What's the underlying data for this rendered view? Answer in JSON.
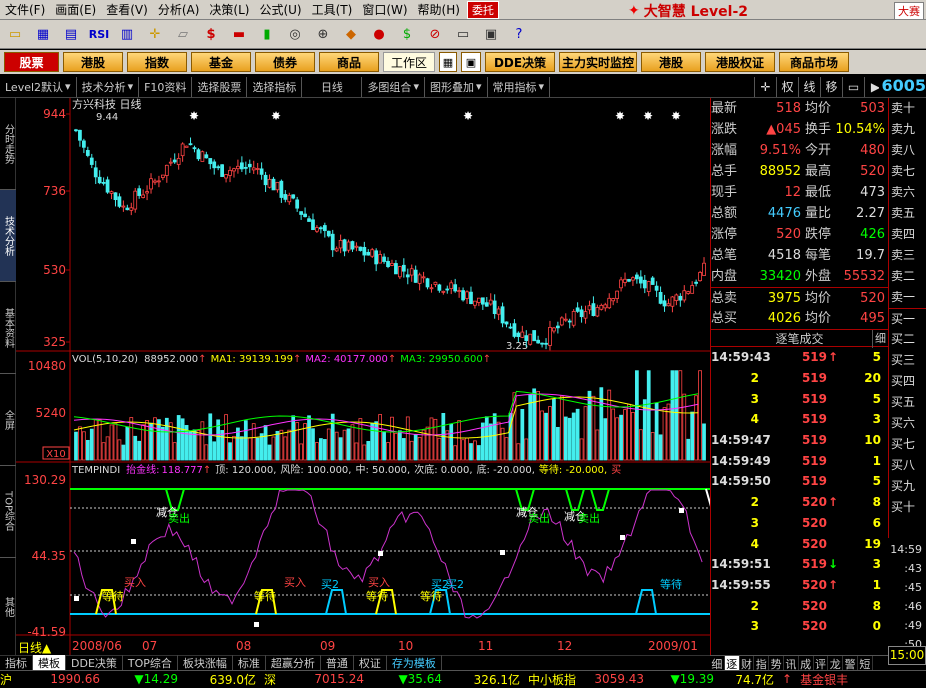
{
  "menu": {
    "items": [
      "文件(F)",
      "画面(E)",
      "查看(V)",
      "分析(A)",
      "决策(L)",
      "公式(U)",
      "工具(T)",
      "窗口(W)",
      "帮助(H)"
    ],
    "weituo": "委托",
    "brand": "大智慧 Level-2",
    "dasai": "大赛"
  },
  "nav": {
    "buttons": [
      "股票",
      "港股",
      "指数",
      "基金",
      "债券",
      "商品"
    ],
    "workzone": "工作区",
    "extra": [
      "DDE决策",
      "主力实时监控",
      "港股",
      "港股权证",
      "商品市场"
    ]
  },
  "tabs": [
    "Level2默认",
    "技术分析",
    "F10资料",
    "选择股票",
    "选择指标",
    "日线",
    "多图组合",
    "图形叠加",
    "常用指标"
  ],
  "tab_icons": [
    "权",
    "线",
    "移"
  ],
  "code_prefix": "6005",
  "left_tabs": [
    "分时走势",
    "技术分析",
    "基本资料",
    "全屏",
    "TOP综合",
    "其他"
  ],
  "chart_data": [
    {
      "type": "candlestick",
      "title": "方兴科技 日线",
      "y_ticks": [
        "944",
        "736",
        "530",
        "325"
      ],
      "ylim": [
        325,
        944
      ],
      "annotations": [
        "9.44",
        "3.25"
      ],
      "note_hi": "9.44",
      "note_lo": "3.25"
    },
    {
      "type": "bar",
      "title": "VOL(5,10,20)",
      "vol_value": "88952.000",
      "series": [
        {
          "name": "MA1",
          "value": "39139.199"
        },
        {
          "name": "MA2",
          "value": "40177.000"
        },
        {
          "name": "MA3",
          "value": "29950.600"
        }
      ],
      "y_ticks": [
        "10480",
        "5240"
      ],
      "unit": "X10"
    },
    {
      "type": "line",
      "title": "TEMPINDI",
      "params_label": "抬金线:",
      "params_value": "118.777",
      "extra": [
        "顶: 120.000,",
        "风险: 100.000,",
        "中: 50.000,",
        "次底: 0.000,",
        "底: -20.000,",
        "等待: -20.000,",
        "买"
      ],
      "y_ticks": [
        "130.29",
        "44.35",
        "-41.59"
      ],
      "signals": [
        "减仓",
        "卖出",
        "减仓",
        "卖出",
        "减仓",
        "卖出",
        "买入",
        "买入",
        "买2",
        "买入",
        "买2",
        "买2",
        "等待",
        "等待",
        "等待",
        "等待",
        "等待"
      ]
    }
  ],
  "x_labels": [
    "2008/06",
    "07",
    "08",
    "09",
    "10",
    "11",
    "12",
    "2009/01"
  ],
  "quote": [
    {
      "l": "最新",
      "v": "518",
      "l2": "均价",
      "v2": "503",
      "c": "#f44",
      "c2": "#f44"
    },
    {
      "l": "涨跌",
      "v": "▲045",
      "l2": "换手",
      "v2": "10.54%",
      "c": "#f44",
      "c2": "#ff0"
    },
    {
      "l": "涨幅",
      "v": "9.51%",
      "l2": "今开",
      "v2": "480",
      "c": "#f44",
      "c2": "#f44"
    },
    {
      "l": "总手",
      "v": "88952",
      "l2": "最高",
      "v2": "520",
      "c": "#ff0",
      "c2": "#f44"
    },
    {
      "l": "现手",
      "v": "12",
      "l2": "最低",
      "v2": "473",
      "c": "#f44",
      "c2": "#ddd"
    },
    {
      "l": "总额",
      "v": "4476",
      "l2": "量比",
      "v2": "2.27",
      "c": "#4cf",
      "c2": "#ddd"
    },
    {
      "l": "涨停",
      "v": "520",
      "l2": "跌停",
      "v2": "426",
      "c": "#f44",
      "c2": "#0f0"
    },
    {
      "l": "总笔",
      "v": "4518",
      "l2": "每笔",
      "v2": "19.7",
      "c": "#ddd",
      "c2": "#ddd"
    },
    {
      "l": "内盘",
      "v": "33420",
      "l2": "外盘",
      "v2": "55532",
      "c": "#0f0",
      "c2": "#f44"
    },
    {
      "l": "总卖",
      "v": "3975",
      "l2": "均价",
      "v2": "520",
      "c": "#ff0",
      "c2": "#f44"
    },
    {
      "l": "总买",
      "v": "4026",
      "l2": "均价",
      "v2": "495",
      "c": "#ff0",
      "c2": "#f44"
    }
  ],
  "trades_header": "逐笔成交",
  "trades_corner": "细",
  "trades": [
    {
      "t": "14:59:43",
      "p": "519",
      "a": "↑",
      "q": "5"
    },
    {
      "t": "2",
      "p": "519",
      "a": "",
      "q": "20"
    },
    {
      "t": "3",
      "p": "519",
      "a": "",
      "q": "5"
    },
    {
      "t": "4",
      "p": "519",
      "a": "",
      "q": "3"
    },
    {
      "t": "14:59:47",
      "p": "519",
      "a": "",
      "q": "10"
    },
    {
      "t": "14:59:49",
      "p": "519",
      "a": "",
      "q": "1"
    },
    {
      "t": "14:59:50",
      "p": "519",
      "a": "",
      "q": "5"
    },
    {
      "t": "2",
      "p": "520",
      "a": "↑",
      "q": "8"
    },
    {
      "t": "3",
      "p": "520",
      "a": "",
      "q": "6"
    },
    {
      "t": "4",
      "p": "520",
      "a": "",
      "q": "19"
    },
    {
      "t": "14:59:51",
      "p": "519",
      "a": "↓",
      "q": "3"
    },
    {
      "t": "14:59:55",
      "p": "520",
      "a": "↑",
      "q": "1"
    },
    {
      "t": "2",
      "p": "520",
      "a": "",
      "q": "8"
    },
    {
      "t": "3",
      "p": "520",
      "a": "",
      "q": "0"
    }
  ],
  "orderbook": [
    "卖十",
    "卖九",
    "卖八",
    "卖七",
    "卖六",
    "卖五",
    "卖四",
    "卖三",
    "卖二",
    "卖一",
    "买一",
    "买二",
    "买三",
    "买四",
    "买五",
    "买六",
    "买七",
    "买八",
    "买九",
    "买十"
  ],
  "mini": [
    "14:59",
    ":43",
    ":45",
    ":46",
    ":49",
    ":50"
  ],
  "time_box": "15:00",
  "bottom_tabs": [
    "指标",
    "模板",
    "DDE决策",
    "TOP综合",
    "板块涨幅",
    "标准",
    "超赢分析",
    "普通",
    "权证",
    "存为模板"
  ],
  "right_tabs": [
    "细",
    "逐",
    "财",
    "指",
    "势",
    "讯",
    "成",
    "评",
    "龙",
    "警",
    "短"
  ],
  "daily_label": "日线▲",
  "status": {
    "sh": "沪",
    "sh_val": "1990.66",
    "sh_chg": "▼14.29",
    "sh_amt": "639.0亿",
    "sz": "深",
    "sz_val": "7015.24",
    "sz_chg": "▼35.64",
    "sz_amt": "326.1亿",
    "zx": "中小板指",
    "zx_val": "3059.43",
    "zx_chg": "▼19.39",
    "zx_amt": "74.7亿",
    "tail": "基金银丰"
  }
}
